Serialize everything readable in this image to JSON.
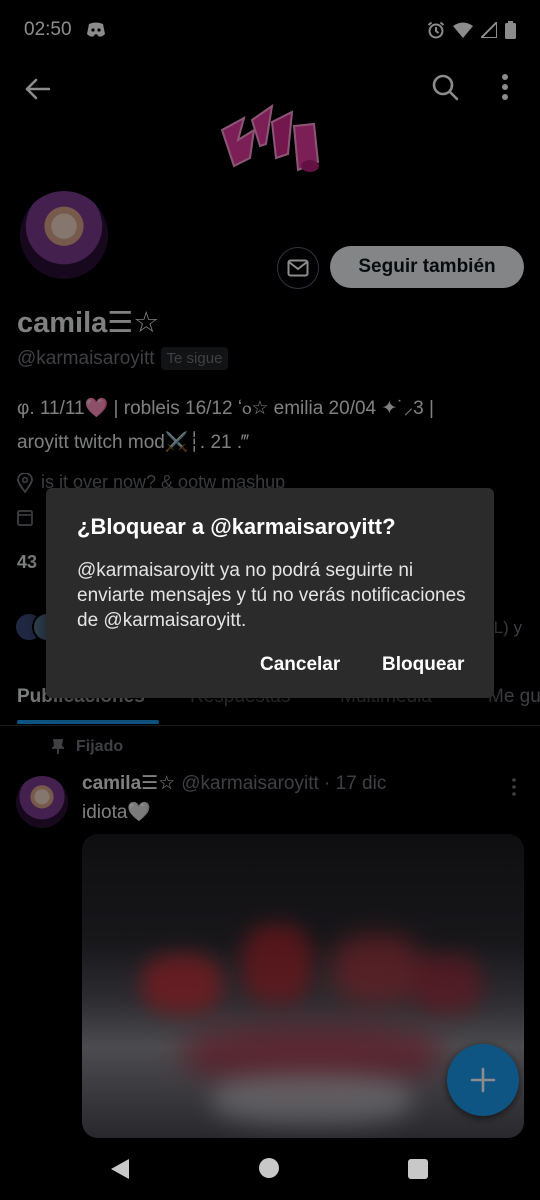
{
  "status_bar": {
    "time": "02:50"
  },
  "profile": {
    "display_name": "camila☰☆",
    "handle": "@karmaisaroyitt",
    "follows_you_badge": "Te sigue",
    "bio_line1": "φ. 11/11🩷  |  robleis 16/12 ʻⲟ☆  emilia 20/04 ✦˙⸝3 |",
    "bio_line2": "aroyitt twitch mod⚔️┆. 21 .‴",
    "location": "is it over now? & ootw mashup",
    "follow_count": "43",
    "followed_by_suffix": "L) y",
    "follow_button_label": "Seguir también"
  },
  "tabs": [
    {
      "label": "Publicaciones"
    },
    {
      "label": "Respuestas"
    },
    {
      "label": "Multimedia"
    },
    {
      "label": "Me gu"
    }
  ],
  "pinned_post": {
    "pinned_label": "Fijado",
    "author_name": "camila☰☆",
    "author_handle": "@karmaisaroyitt · 17 dic",
    "text": "idiota🤍"
  },
  "dialog": {
    "title": "¿Bloquear a @karmaisaroyitt?",
    "body": "@karmaisaroyitt ya no podrá seguirte ni enviarte mensajes y tú no verás notificaciones de @karmaisaroyitt.",
    "cancel_label": "Cancelar",
    "block_label": "Bloquear"
  },
  "colors": {
    "accent": "#1d9bf0",
    "background": "#000000",
    "dialog_bg": "#2b2b2b",
    "muted_text": "#71767b",
    "logo_pink": "#e43a9f"
  }
}
